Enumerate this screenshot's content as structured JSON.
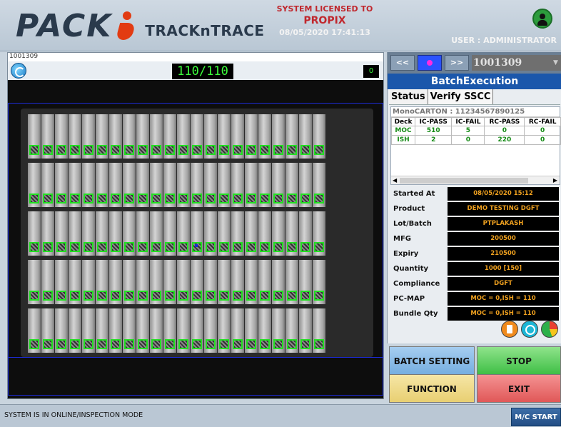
{
  "header": {
    "logo_main": "PACK",
    "logo_sub": "TRACKnTRACE",
    "license_line1": "SYSTEM LICENSED TO",
    "license_line2": "PROPIX",
    "datetime": "08/05/2020 17:41:13",
    "user_label": "USER : ADMINISTRATOR"
  },
  "camera": {
    "title": "1001309",
    "counter": "110/110",
    "counter_small": "0"
  },
  "nav": {
    "prev_label": "<<",
    "next_label": ">>",
    "batch_number": "1001309"
  },
  "batch": {
    "title": "BatchExecution",
    "tabs": [
      "Status",
      "Verify SSCC"
    ],
    "mono_carton": "MonoCARTON : 11234567890125",
    "deck_headers": [
      "Deck",
      "IC-PASS",
      "IC-FAIL",
      "RC-PASS",
      "RC-FAIL"
    ],
    "deck_rows": [
      [
        "MOC",
        "510",
        "5",
        "0",
        "0"
      ],
      [
        "ISH",
        "2",
        "0",
        "220",
        "0"
      ]
    ],
    "info": [
      {
        "label": "Started At",
        "value": "08/05/2020 15:12"
      },
      {
        "label": "Product",
        "value": "DEMO TESTING DGFT"
      },
      {
        "label": "Lot/Batch",
        "value": "PTPLAKASH"
      },
      {
        "label": "MFG",
        "value": "200500"
      },
      {
        "label": "Expiry",
        "value": "210500"
      },
      {
        "label": "Quantity",
        "value": "1000 [150]"
      },
      {
        "label": "Compliance",
        "value": "DGFT"
      },
      {
        "label": "PC-MAP",
        "value": "MOC = 0,ISH = 110"
      },
      {
        "label": "Bundle Qty",
        "value": "MOC = 0,ISH = 110"
      }
    ]
  },
  "actions": {
    "batch_setting": "BATCH SETTING",
    "stop": "STOP",
    "function": "FUNCTION",
    "exit": "EXIT"
  },
  "status_bar": {
    "message": "SYSTEM IS IN ONLINE/INSPECTION MODE",
    "mc_start": "M/C START"
  },
  "icons": [
    "report-icon",
    "settings-circle-icon",
    "pie-chart-icon"
  ],
  "colors": {
    "accent": "#1b57ab",
    "counter_green": "#3cff3c",
    "value_orange": "#f0a11f",
    "code_frame_green": "#22e022"
  }
}
